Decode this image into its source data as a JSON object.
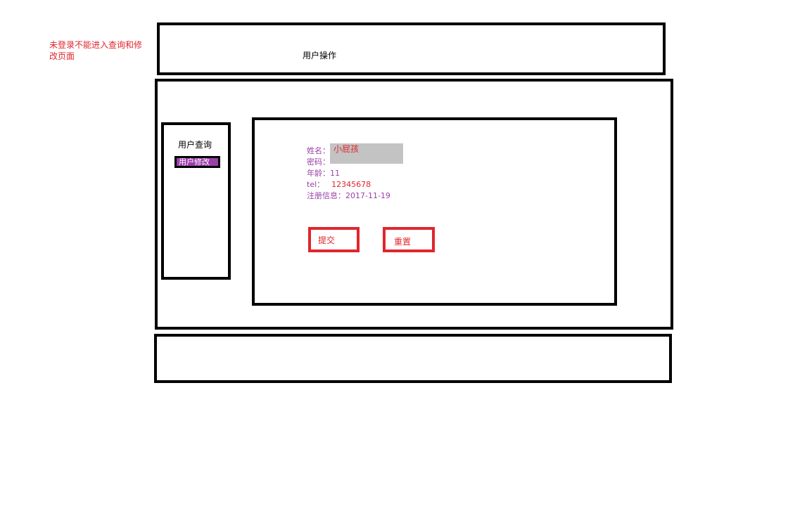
{
  "note": {
    "text": "未登录不能进入查询和修改页面"
  },
  "header": {
    "title": "用户操作"
  },
  "sidebar": {
    "items": [
      {
        "label": "用户查询"
      },
      {
        "label": "用户修改"
      }
    ]
  },
  "form": {
    "name": {
      "label": "姓名：",
      "value": "小屁孩"
    },
    "password": {
      "label": "密码：",
      "value": ""
    },
    "age": {
      "label": "年龄：",
      "value": "11"
    },
    "tel": {
      "label": "tel：",
      "value": "12345678"
    },
    "register": {
      "label": "注册信息：",
      "value": "2017-11-19"
    }
  },
  "buttons": {
    "submit_label": "提交",
    "reset_label": "重置"
  },
  "colors": {
    "note": "#e0262d",
    "border": "#000000",
    "button_border": "#e0262d",
    "label": "#9b3fa8",
    "sidebar_active_bg": "#9b3fa8",
    "name_field_bg": "#c3c3c3"
  }
}
